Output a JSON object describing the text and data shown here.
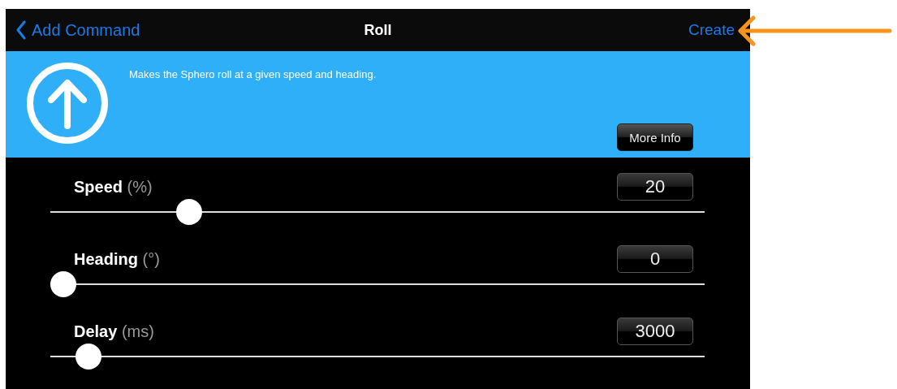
{
  "nav": {
    "back": "Add Command",
    "title": "Roll",
    "action": "Create"
  },
  "command": {
    "description": "Makes the Sphero roll at a given speed and heading.",
    "more_info": "More Info"
  },
  "parameters": [
    {
      "name": "Speed",
      "unit": "(%)",
      "value": "20",
      "level": 0.2
    },
    {
      "name": "Heading",
      "unit": "(°)",
      "value": "0",
      "level": 0
    },
    {
      "name": "Delay",
      "unit": "(ms)",
      "value": "3000",
      "level": 0.04
    }
  ]
}
